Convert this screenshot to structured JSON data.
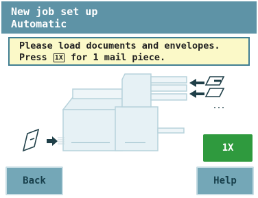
{
  "header": {
    "title": "New job set up",
    "subtitle": "Automatic"
  },
  "instruction": {
    "line1": "Please load documents and envelopes.",
    "line2_before": "Press ",
    "key_label": "1X",
    "line2_after": " for 1 mail piece."
  },
  "illustration": {
    "more_indicator": "..."
  },
  "buttons": {
    "one_x": "1X",
    "back": "Back",
    "help": "Help"
  },
  "colors": {
    "header": "#5e93a6",
    "instruction_bg": "#fbf9c8",
    "instruction_border": "#3f7e92",
    "action_button": "#2f9a3e",
    "nav_button": "#74a7b7"
  }
}
